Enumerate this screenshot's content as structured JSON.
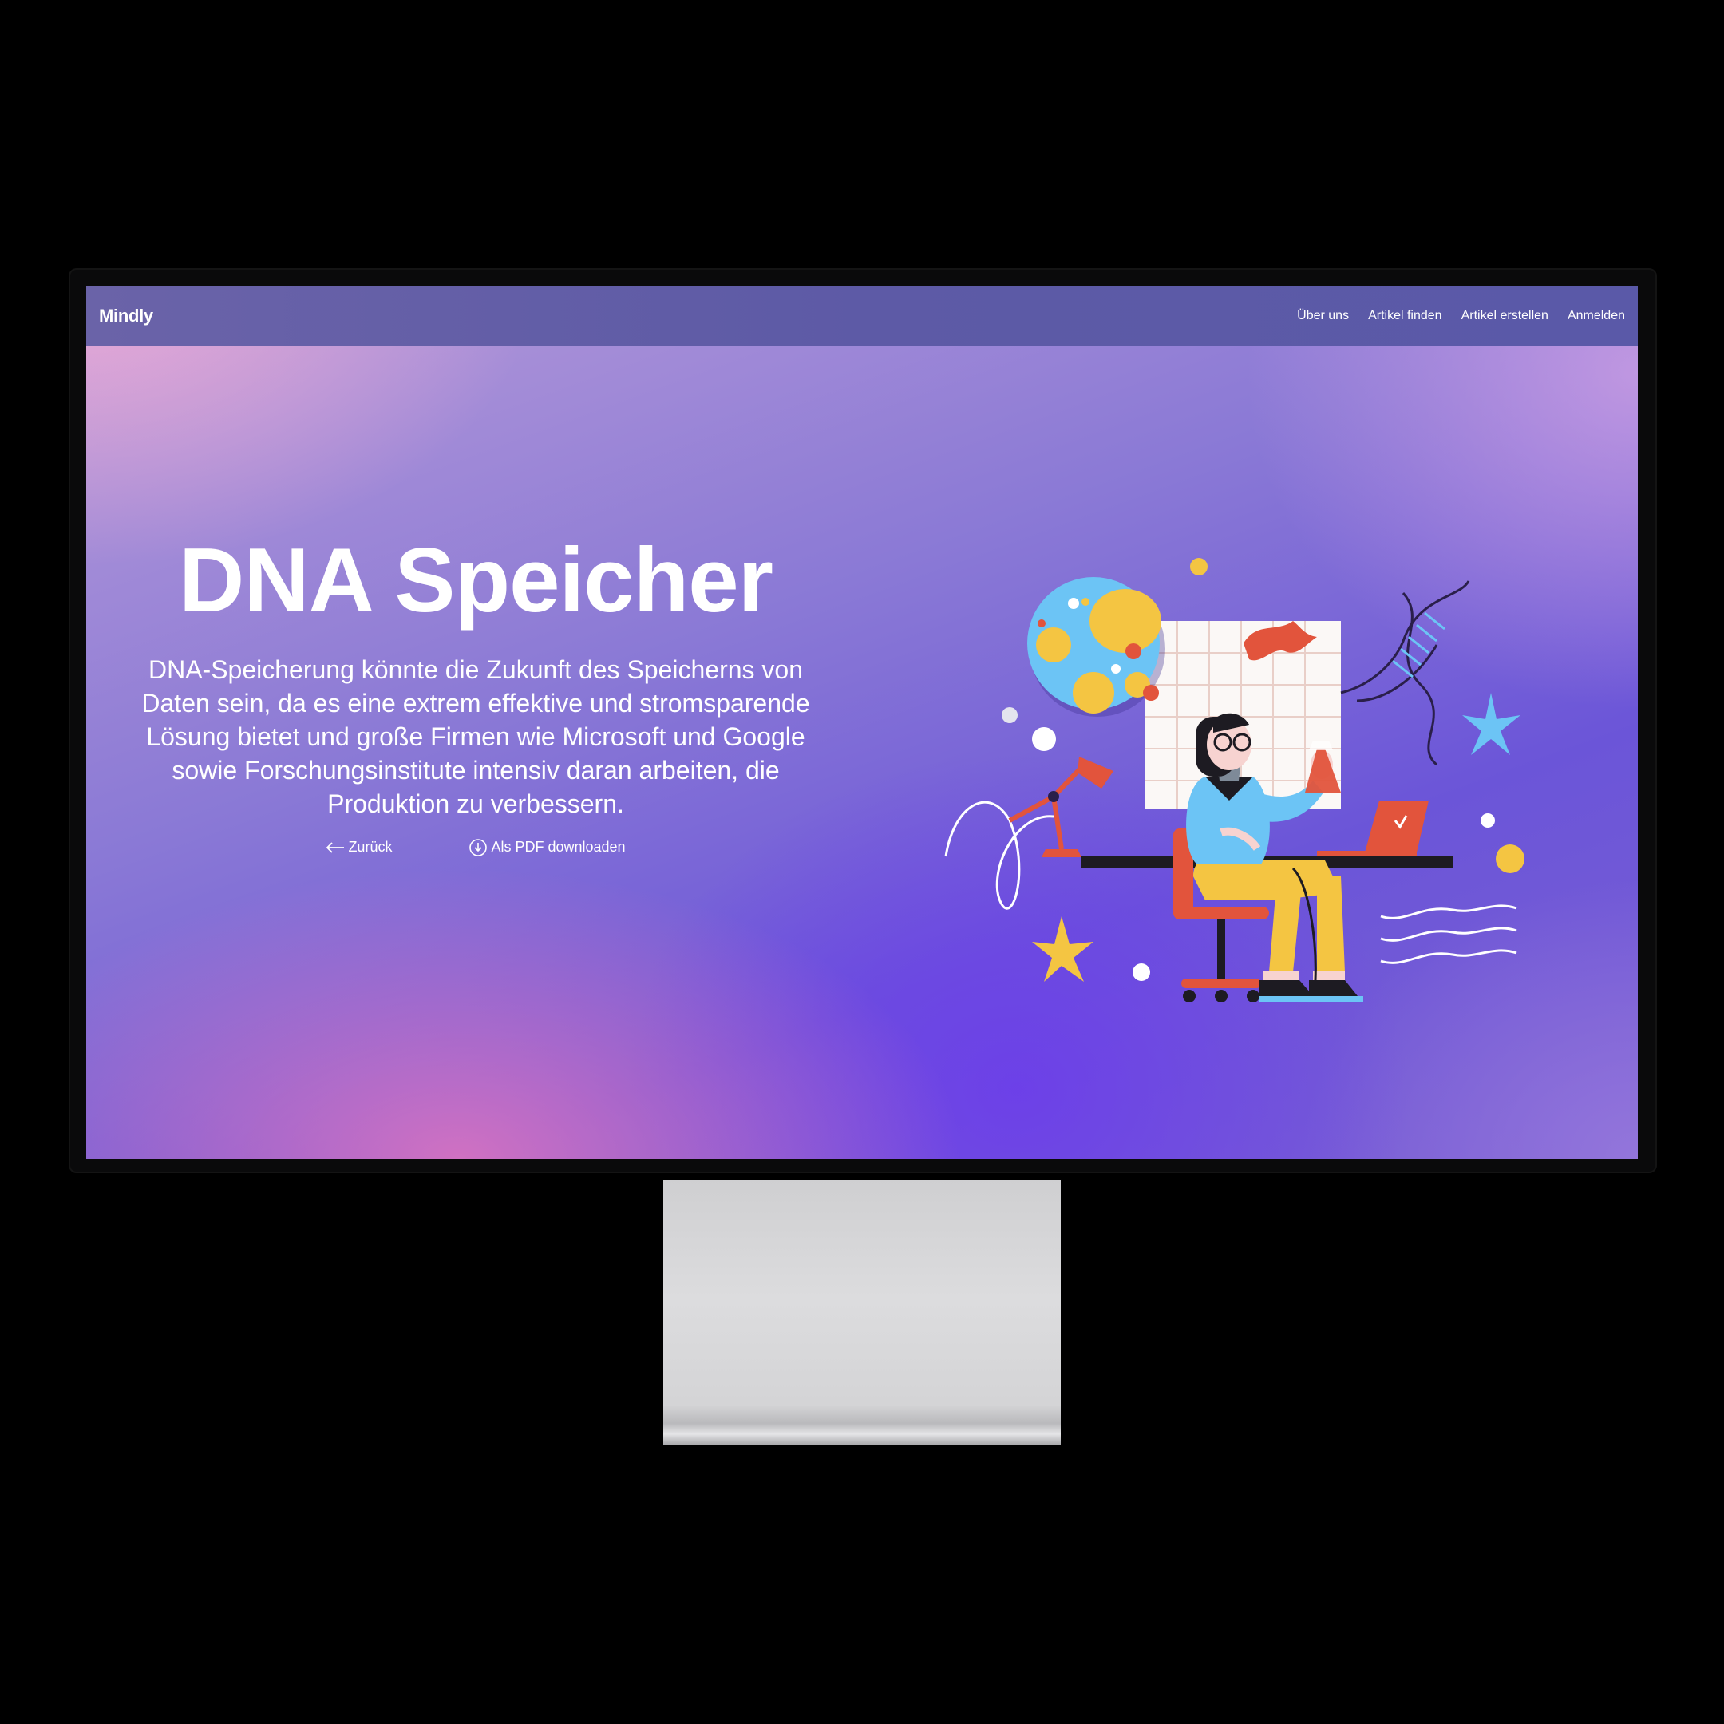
{
  "navbar": {
    "brand": "Mindly",
    "links": [
      "Über uns",
      "Artikel finden",
      "Artikel erstellen",
      "Anmelden"
    ]
  },
  "hero": {
    "title": "DNA Speicher",
    "description": "DNA-Speicherung könnte die Zukunft des Speicherns von Daten sein, da es eine extrem effektive und stromsparende Lösung bietet und große Firmen wie Microsoft und Google sowie Forschungsinstitute intensiv daran arbeiten, die Produktion zu verbessern.",
    "back_label": "Zurück",
    "download_label": "Als PDF downloaden"
  },
  "icons": {
    "back": "arrow-left-icon",
    "download": "download-circle-icon"
  },
  "colors": {
    "navbar": "#5d5aa6",
    "text": "#ffffff",
    "accent_red": "#e2543c",
    "accent_yellow": "#f4c542",
    "accent_blue": "#6cc4f5"
  }
}
